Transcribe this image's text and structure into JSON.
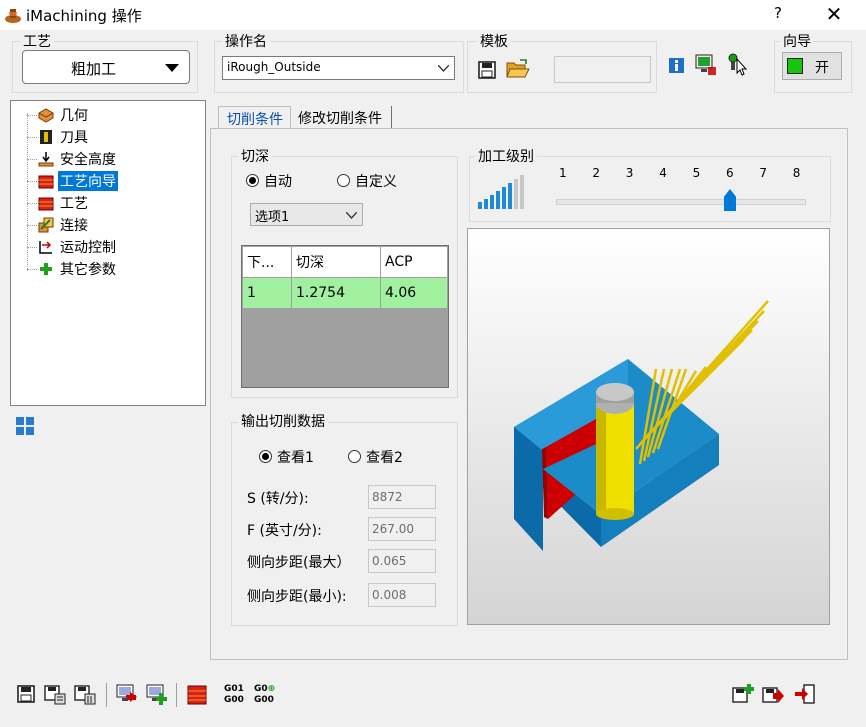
{
  "window": {
    "title": "iMachining 操作",
    "help_label": "?",
    "close_label": "✕",
    "app_icon": "imachining-app-icon"
  },
  "process_group": {
    "label": "工艺",
    "selected": "粗加工"
  },
  "operation_group": {
    "label": "操作名",
    "value": "iRough_Outside"
  },
  "template_group": {
    "label": "模板",
    "value": ""
  },
  "wizard_group": {
    "label": "向导",
    "toggle_label": "开",
    "indicator_color": "#16c60c"
  },
  "tree": {
    "items": [
      {
        "label": "几何",
        "icon": "geometry-icon"
      },
      {
        "label": "刀具",
        "icon": "tool-icon"
      },
      {
        "label": "安全高度",
        "icon": "safety-height-icon"
      },
      {
        "label": "工艺向导",
        "icon": "technology-wizard-icon",
        "selected": true
      },
      {
        "label": "工艺",
        "icon": "technology-icon"
      },
      {
        "label": "连接",
        "icon": "link-icon"
      },
      {
        "label": "运动控制",
        "icon": "motion-control-icon"
      },
      {
        "label": "其它参数",
        "icon": "misc-parameters-icon"
      }
    ]
  },
  "tabs": [
    {
      "label": "切削条件",
      "active": true
    },
    {
      "label": "修改切削条件",
      "active": false
    }
  ],
  "depth_group": {
    "label": "切深",
    "radio_auto": "自动",
    "radio_custom": "自定义",
    "selected_radio": "自动",
    "option_value": "选项1",
    "table": {
      "headers": [
        "下...",
        "切深",
        "ACP"
      ],
      "rows": [
        [
          "1",
          "1.2754",
          "4.06"
        ]
      ],
      "highlight_color": "#a0f0a0"
    }
  },
  "machining_level": {
    "label": "加工级别",
    "ticks": [
      "1",
      "2",
      "3",
      "4",
      "5",
      "6",
      "7",
      "8"
    ],
    "value": 6
  },
  "output_group": {
    "label": "输出切削数据",
    "radio_view1": "查看1",
    "radio_view2": "查看2",
    "selected_radio": "查看1",
    "fields": [
      {
        "label": "S (转/分):",
        "value": "8872"
      },
      {
        "label": "F (英寸/分):",
        "value": "267.00"
      },
      {
        "label": "侧向步距(最大）",
        "value": "0.065"
      },
      {
        "label": "侧向步距(最小):",
        "value": "0.008"
      }
    ]
  },
  "bottom_toolbar": {
    "g01": "G01",
    "g00": "G00",
    "g0plus": "G0",
    "left_icons": [
      "save-icon",
      "save-and-calculate-icon",
      "save-all-icon",
      "simulate-icon",
      "simulate-all-icon",
      "stock-icon",
      "gcode-icon",
      "gcode-all-icon"
    ],
    "right_icons": [
      "save-new-icon",
      "save-and-next-icon",
      "exit-icon"
    ]
  },
  "colors": {
    "selection": "#0078d7",
    "part_blue": "#1c8cc8",
    "fixture_red": "#cc0000",
    "tool_yellow": "#f0e000",
    "path_gold": "#e0c000"
  }
}
